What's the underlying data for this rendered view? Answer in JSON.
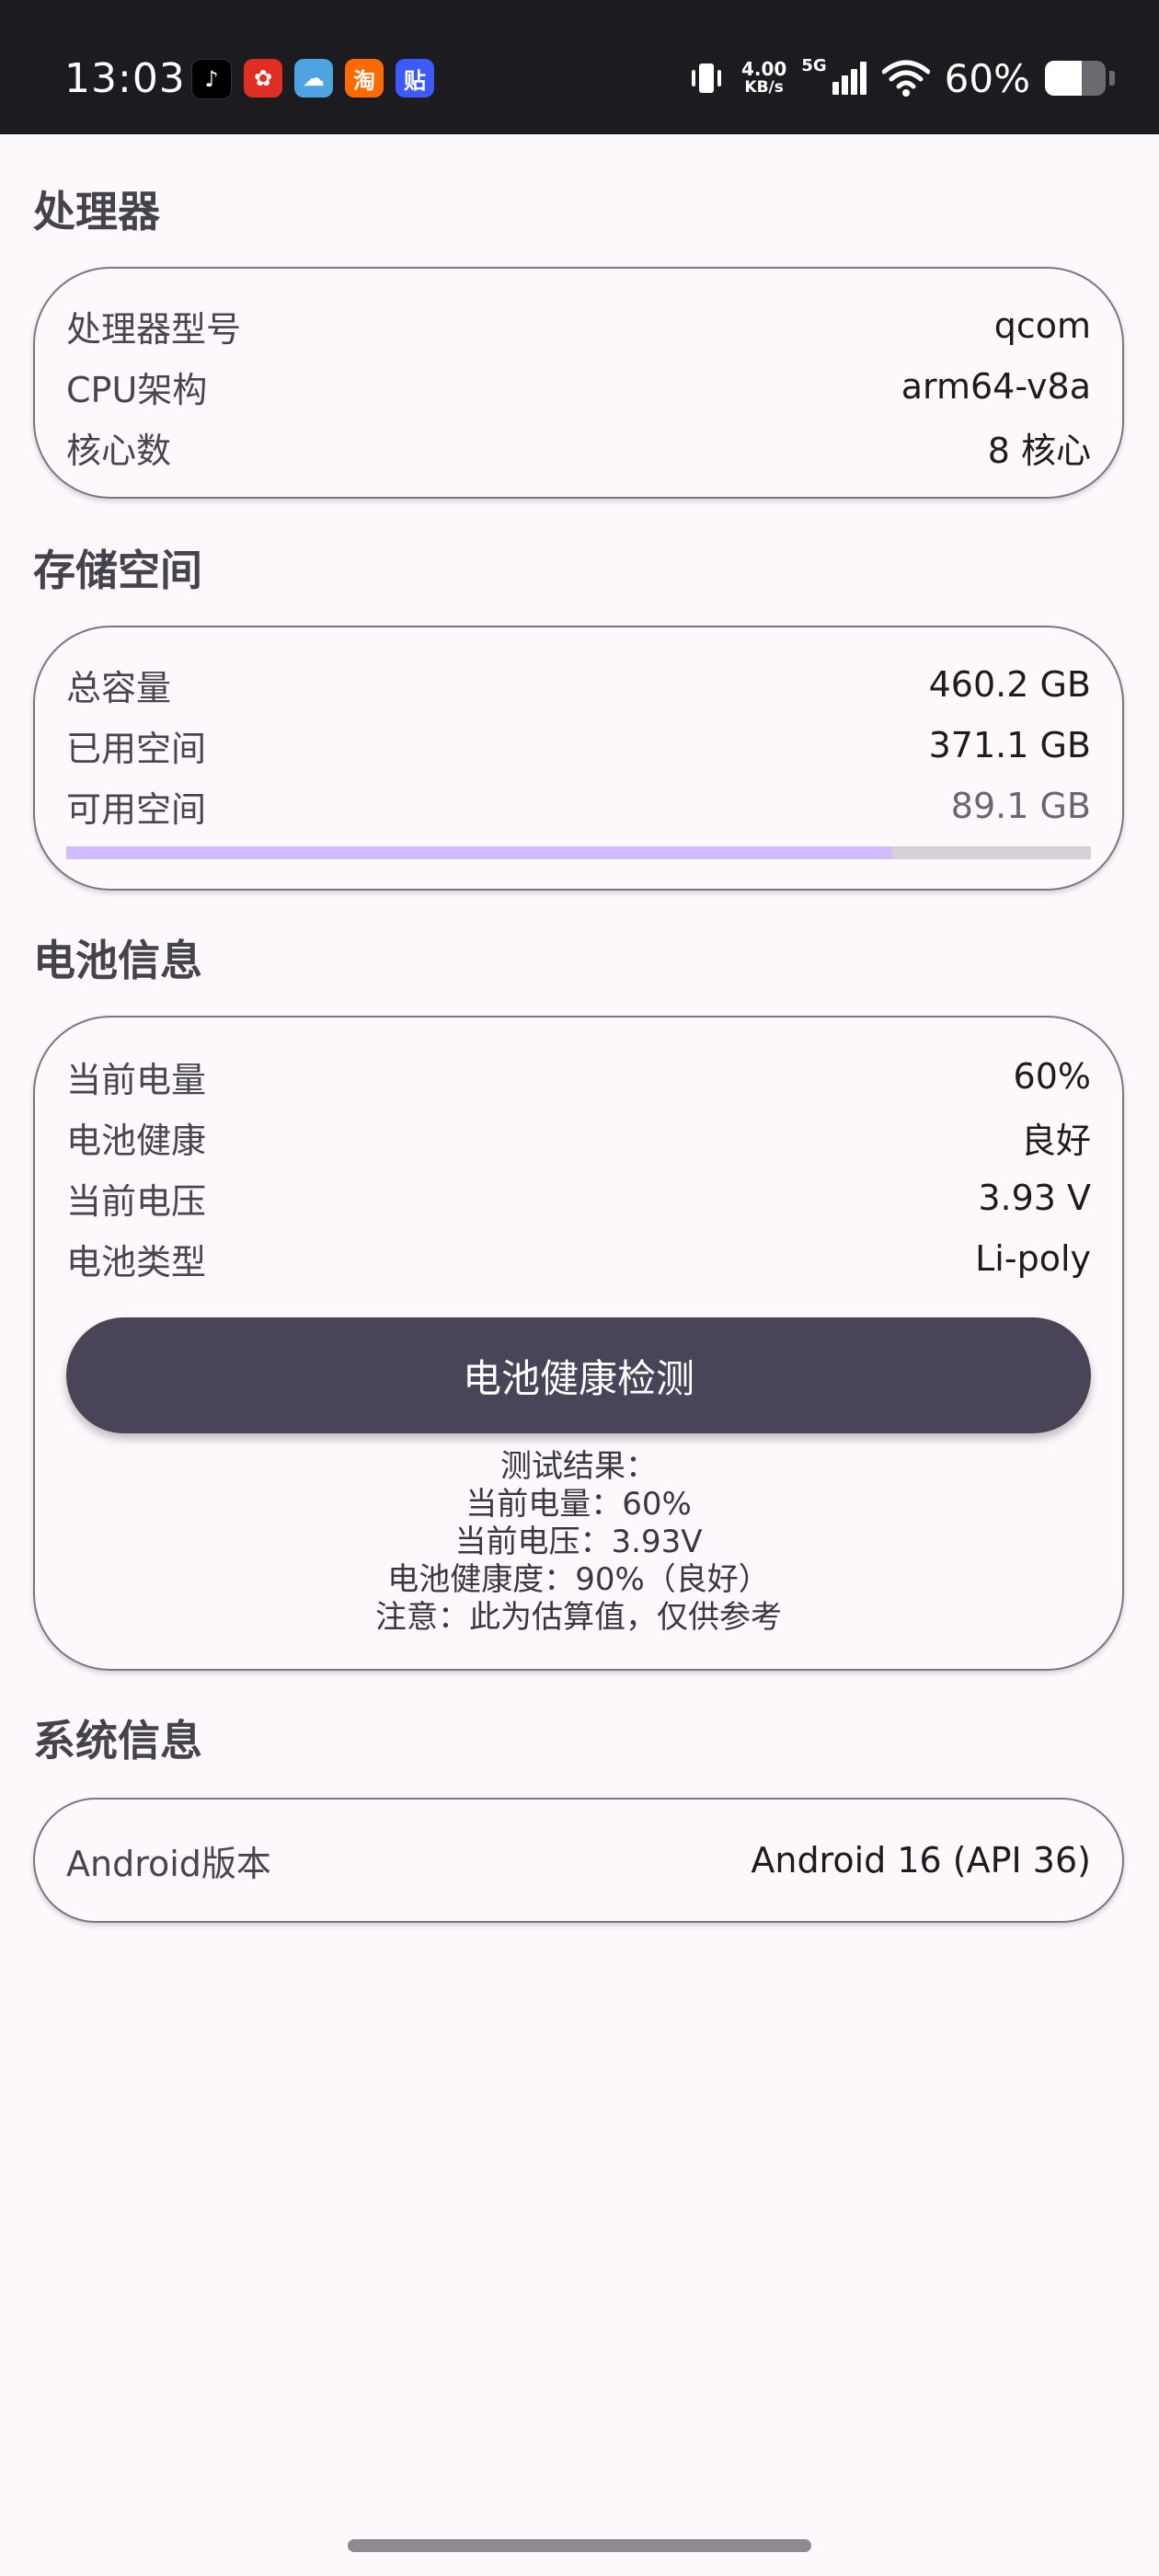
{
  "status_bar": {
    "time": "13:03",
    "apps": [
      {
        "icon": "tiktok-icon",
        "glyph": "♪",
        "color": "#000000"
      },
      {
        "icon": "pinduoduo-icon",
        "glyph": "✿",
        "color": "#e02e24"
      },
      {
        "icon": "cloud-app-icon",
        "glyph": "☁",
        "color": "#4fa3e0"
      },
      {
        "icon": "taobao-icon",
        "glyph": "淘",
        "color": "#ff6a00"
      },
      {
        "icon": "tieba-icon",
        "glyph": "贴",
        "color": "#3d5afe"
      }
    ],
    "net_speed_value": "4.00",
    "net_speed_unit": "KB/s",
    "network_gen": "5G",
    "battery_percent": "60%",
    "battery_level": 0.6
  },
  "processor": {
    "title": "处理器",
    "rows": [
      {
        "label": "处理器型号",
        "value": "qcom"
      },
      {
        "label": "CPU架构",
        "value": "arm64-v8a"
      },
      {
        "label": "核心数",
        "value": "8 核心"
      }
    ]
  },
  "storage": {
    "title": "存储空间",
    "rows": [
      {
        "label": "总容量",
        "value": "460.2 GB"
      },
      {
        "label": "已用空间",
        "value": "371.1 GB"
      },
      {
        "label": "可用空间",
        "value": "89.1 GB"
      }
    ],
    "used_fraction": 0.806,
    "bar_color": "#d0bcff"
  },
  "battery": {
    "title": "电池信息",
    "rows": [
      {
        "label": "当前电量",
        "value": "60%"
      },
      {
        "label": "电池健康",
        "value": "良好"
      },
      {
        "label": "当前电压",
        "value": "3.93 V"
      },
      {
        "label": "电池类型",
        "value": "Li-poly"
      }
    ],
    "test_button_label": "电池健康检测",
    "test_results": [
      "测试结果：",
      "当前电量：60%",
      "当前电压：3.93V",
      "电池健康度：90%（良好）",
      "注意：此为估算值，仅供参考"
    ]
  },
  "system": {
    "title": "系统信息",
    "rows": [
      {
        "label": "Android版本",
        "value": "Android 16 (API 36)"
      }
    ]
  },
  "colors": {
    "background": "#fdf8fc",
    "button": "#4a4458",
    "accent": "#d0bcff"
  }
}
